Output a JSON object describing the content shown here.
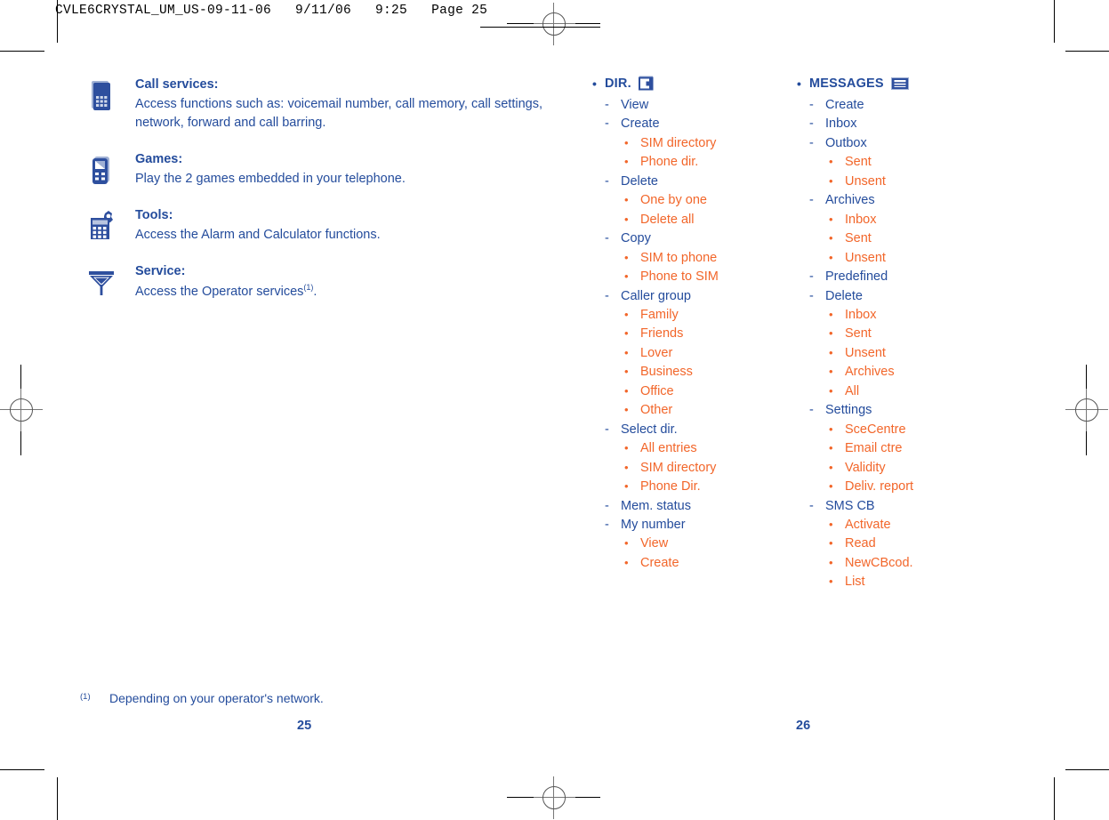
{
  "header": {
    "slug": "CVLE6CRYSTAL_UM_US-09-11-06   9/11/06   9:25   Page 25"
  },
  "colors": {
    "blue": "#244C9C",
    "orange": "#F2662A",
    "paper": "#ffffff",
    "crop_mark": "#000000"
  },
  "left_column": {
    "features": [
      {
        "icon": "mobile-phone-icon",
        "title": "Call services:",
        "body": "Access functions such as: voicemail number, call memory, call settings, network, forward and call barring."
      },
      {
        "icon": "game-controller-icon",
        "title": "Games:",
        "body": "Play the 2 games embedded in your telephone."
      },
      {
        "icon": "calculator-icon",
        "title": "Tools:",
        "body": "Access the Alarm and Calculator functions."
      },
      {
        "icon": "antenna-service-icon",
        "title": "Service:",
        "body": "Access the Operator services",
        "footnote_ref": "(1)",
        "body_suffix": "."
      }
    ]
  },
  "middle_column": {
    "heading": {
      "bullet": "•",
      "label": "DIR.",
      "icon": "directory-book-icon"
    },
    "items": [
      {
        "marker": "-",
        "label": "View",
        "children": []
      },
      {
        "marker": "-",
        "label": "Create",
        "children": [
          {
            "marker": "•",
            "label": "SIM directory"
          },
          {
            "marker": "•",
            "label": "Phone dir."
          }
        ]
      },
      {
        "marker": "-",
        "label": "Delete",
        "children": [
          {
            "marker": "•",
            "label": "One by one"
          },
          {
            "marker": "•",
            "label": "Delete all"
          }
        ]
      },
      {
        "marker": "-",
        "label": "Copy",
        "children": [
          {
            "marker": "•",
            "label": "SIM to phone"
          },
          {
            "marker": "•",
            "label": "Phone to SIM"
          }
        ]
      },
      {
        "marker": "-",
        "label": "Caller group",
        "children": [
          {
            "marker": "•",
            "label": "Family"
          },
          {
            "marker": "•",
            "label": "Friends"
          },
          {
            "marker": "•",
            "label": "Lover"
          },
          {
            "marker": "•",
            "label": "Business"
          },
          {
            "marker": "•",
            "label": "Office"
          },
          {
            "marker": "•",
            "label": "Other"
          }
        ]
      },
      {
        "marker": "-",
        "label": "Select dir.",
        "children": [
          {
            "marker": "•",
            "label": "All entries"
          },
          {
            "marker": "•",
            "label": "SIM directory"
          },
          {
            "marker": "•",
            "label": "Phone Dir."
          }
        ]
      },
      {
        "marker": "-",
        "label": "Mem. status",
        "children": []
      },
      {
        "marker": "-",
        "label": "My number",
        "children": [
          {
            "marker": "•",
            "label": "View"
          },
          {
            "marker": "•",
            "label": "Create"
          }
        ]
      }
    ]
  },
  "right_column": {
    "heading": {
      "bullet": "•",
      "label": "MESSAGES",
      "icon": "envelope-icon"
    },
    "items": [
      {
        "marker": "-",
        "label": "Create",
        "children": []
      },
      {
        "marker": "-",
        "label": "Inbox",
        "children": []
      },
      {
        "marker": "-",
        "label": "Outbox",
        "children": [
          {
            "marker": "•",
            "label": "Sent"
          },
          {
            "marker": "•",
            "label": "Unsent"
          }
        ]
      },
      {
        "marker": "-",
        "label": "Archives",
        "children": [
          {
            "marker": "•",
            "label": "Inbox"
          },
          {
            "marker": "•",
            "label": "Sent"
          },
          {
            "marker": "•",
            "label": "Unsent"
          }
        ]
      },
      {
        "marker": "-",
        "label": "Predefined",
        "children": []
      },
      {
        "marker": "-",
        "label": "Delete",
        "children": [
          {
            "marker": "•",
            "label": "Inbox"
          },
          {
            "marker": "•",
            "label": "Sent"
          },
          {
            "marker": "•",
            "label": "Unsent"
          },
          {
            "marker": "•",
            "label": "Archives"
          },
          {
            "marker": "•",
            "label": "All"
          }
        ]
      },
      {
        "marker": "-",
        "label": "Settings",
        "children": [
          {
            "marker": "•",
            "label": "SceCentre"
          },
          {
            "marker": "•",
            "label": "Email ctre"
          },
          {
            "marker": "•",
            "label": "Validity"
          },
          {
            "marker": "•",
            "label": "Deliv. report"
          }
        ]
      },
      {
        "marker": "-",
        "label": "SMS CB",
        "children": [
          {
            "marker": "•",
            "label": "Activate"
          },
          {
            "marker": "•",
            "label": "Read"
          },
          {
            "marker": "•",
            "label": "NewCBcod."
          },
          {
            "marker": "•",
            "label": "List"
          }
        ]
      }
    ]
  },
  "footer": {
    "footnote_mark": "(1)",
    "footnote_text": "Depending on your operator's network.",
    "page_left": "25",
    "page_right": "26"
  }
}
